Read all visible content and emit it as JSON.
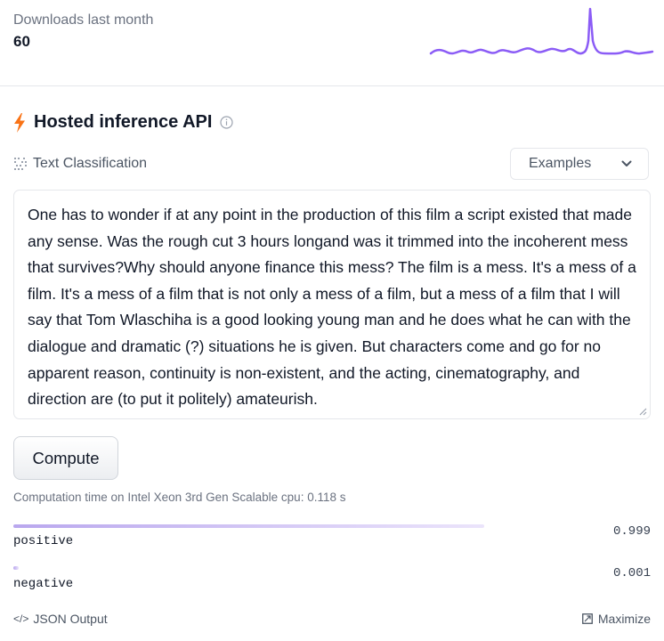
{
  "downloads": {
    "label": "Downloads last month",
    "value": "60"
  },
  "inference": {
    "title": "Hosted inference API",
    "task_label": "Text Classification",
    "examples_label": "Examples",
    "input_text": "One has to wonder if at any point in the production of this film a script existed that made any sense. Was the rough cut 3 hours longand was it trimmed into the incoherent mess that survives?Why should anyone finance this mess? The film is a mess. It's a mess of a film. It's a mess of a film that is not only a mess of a film, but a mess of a film that I will say that Tom Wlaschiha is a good looking young man and he does what he can with the dialogue and dramatic (?) situations he is given. But characters come and go for no apparent reason, continuity is non-existent, and the acting, cinematography, and direction are (to put it politely) amateurish.",
    "compute_label": "Compute",
    "computation_time": "Computation time on Intel Xeon 3rd Gen Scalable cpu: 0.118 s",
    "results": [
      {
        "label": "positive",
        "score_text": "0.999",
        "score": 0.999
      },
      {
        "label": "negative",
        "score_text": "0.001",
        "score": 0.001
      }
    ],
    "json_output_label": "JSON Output",
    "maximize_label": "Maximize"
  },
  "colors": {
    "accent_purple": "#8b5cf6",
    "bolt_orange": "#f97316"
  },
  "icons": [
    "lightning-icon",
    "info-icon",
    "classification-icon",
    "chevron-down-icon",
    "code-icon",
    "maximize-icon"
  ]
}
